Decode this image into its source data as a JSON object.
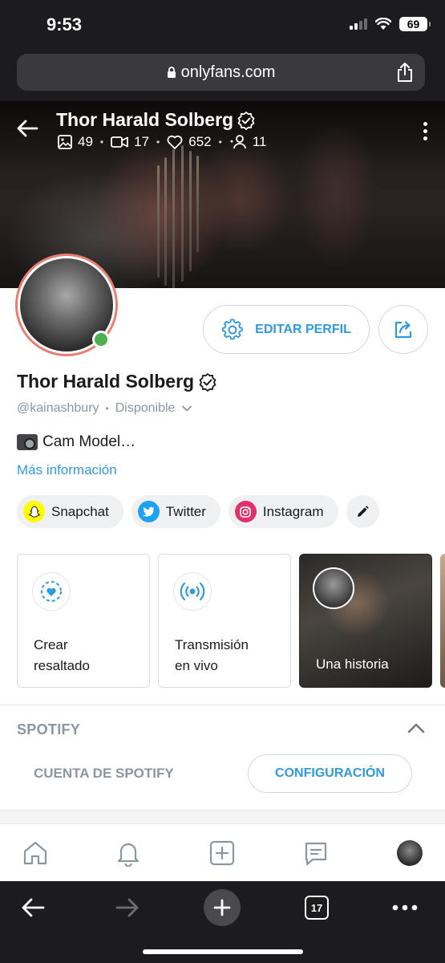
{
  "status_bar": {
    "time": "9:53",
    "battery": "69"
  },
  "browser": {
    "url": "onlyfans.com",
    "tab_count": "17"
  },
  "cover": {
    "title": "Thor Harald Solberg",
    "stats": {
      "photos": "49",
      "videos": "17",
      "likes": "652",
      "fans": "11"
    }
  },
  "profile": {
    "name": "Thor Harald Solberg",
    "handle": "@kainashbury",
    "separator": "•",
    "availability": "Disponible",
    "bio": "Cam Model…",
    "more_info": "Más información",
    "edit_label": "EDITAR PERFIL"
  },
  "socials": [
    {
      "label": "Snapchat",
      "color": "#FFFC00"
    },
    {
      "label": "Twitter",
      "color": "#1DA1F2"
    },
    {
      "label": "Instagram",
      "color": "#E1306C"
    }
  ],
  "highlights": {
    "create": "Crear\nresaltado",
    "live": "Transmisión\nen vivo",
    "story": "Una historia"
  },
  "spotify": {
    "title": "SPOTIFY",
    "account": "CUENTA DE SPOTIFY",
    "config": "CONFIGURACIÓN"
  },
  "colors": {
    "accent": "#2E9BE0",
    "online": "#4CAF50",
    "avatar_ring": "#E87E6F"
  }
}
